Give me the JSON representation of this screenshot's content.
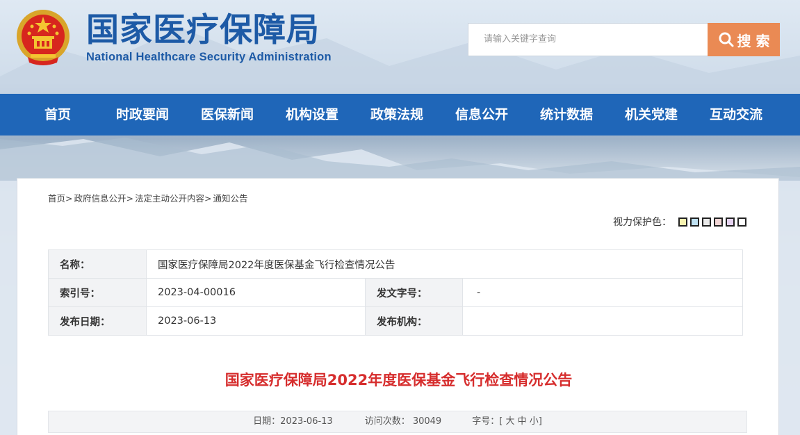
{
  "header": {
    "title_cn": "国家医疗保障局",
    "title_en": "National Healthcare Security Administration",
    "search_placeholder": "请输入关键字查询",
    "search_button": "搜 索"
  },
  "nav": {
    "items": [
      "首页",
      "时政要闻",
      "医保新闻",
      "机构设置",
      "政策法规",
      "信息公开",
      "统计数据",
      "机关党建",
      "互动交流"
    ]
  },
  "breadcrumb": [
    "首页>",
    "政府信息公开>",
    "法定主动公开内容>",
    "通知公告"
  ],
  "eye_protect": {
    "label": "视力保护色：",
    "swatches": [
      "#f7f3b0",
      "#bfe1f2",
      "#e9e9e9",
      "#f2d6d6",
      "#e6d3f0",
      "#ffffff"
    ]
  },
  "meta": {
    "name_label": "名称：",
    "name_value": "国家医疗保障局2022年度医保基金飞行检查情况公告",
    "index_label": "索引号：",
    "index_value": "2023-04-00016",
    "docno_label": "发文字号：",
    "docno_value": "-",
    "date_label": "发布日期：",
    "date_value": "2023-06-13",
    "org_label": "发布机构：",
    "org_value": ""
  },
  "article": {
    "title": "国家医疗保障局2022年度医保基金飞行检查情况公告",
    "date_text": "日期：2023-06-13",
    "visits_text": "访问次数： 30049",
    "fontsize_label": "字号：[",
    "font_large": "大",
    "font_medium": "中",
    "font_small": "小",
    "fontsize_close": "]"
  }
}
